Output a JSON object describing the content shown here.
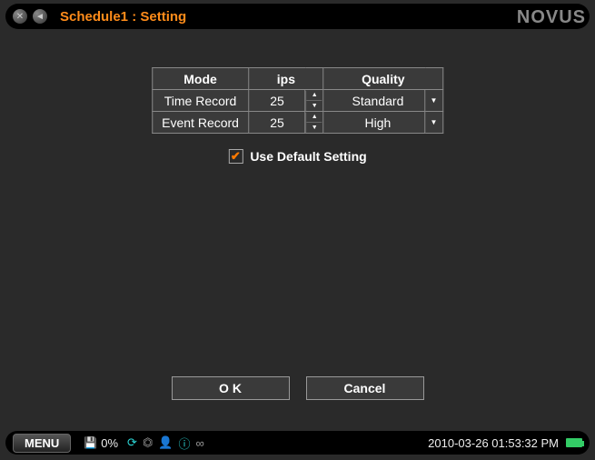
{
  "titlebar": {
    "title": "Schedule1 : Setting"
  },
  "brand": "NOVUS",
  "table": {
    "headers": {
      "mode": "Mode",
      "ips": "ips",
      "quality": "Quality"
    },
    "rows": [
      {
        "mode": "Time Record",
        "ips": "25",
        "quality": "Standard"
      },
      {
        "mode": "Event Record",
        "ips": "25",
        "quality": "High"
      }
    ]
  },
  "checkbox": {
    "label": "Use Default Setting",
    "checked": true
  },
  "buttons": {
    "ok": "O K",
    "cancel": "Cancel"
  },
  "statusbar": {
    "menu": "MENU",
    "disk_pct": "0%",
    "datetime": "2010-03-26 01:53:32 PM"
  }
}
